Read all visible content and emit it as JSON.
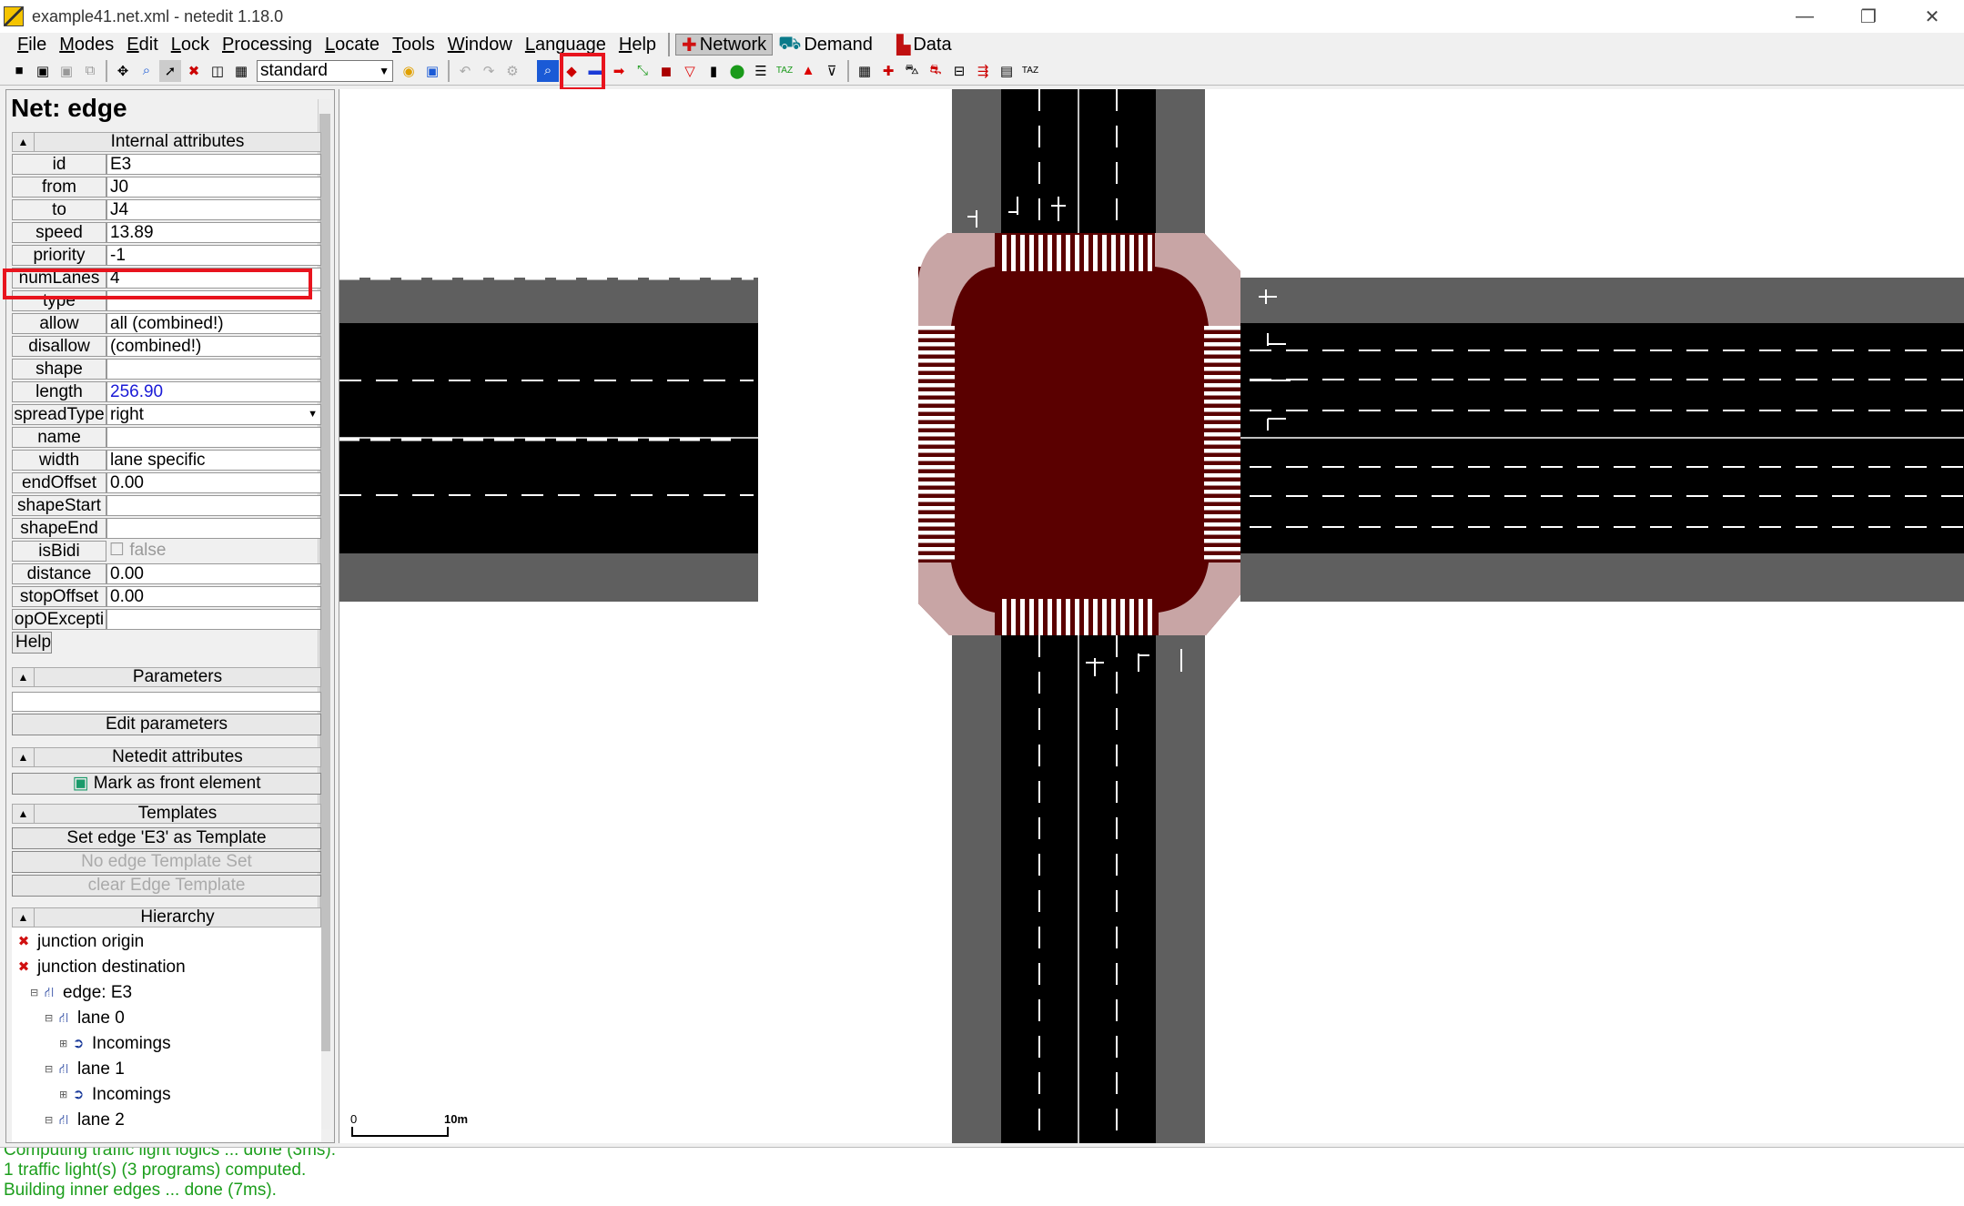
{
  "window": {
    "title": "example41.net.xml - netedit 1.18.0",
    "controls": [
      "—",
      "❐",
      "✕"
    ]
  },
  "menu": [
    "File",
    "Modes",
    "Edit",
    "Lock",
    "Processing",
    "Locate",
    "Tools",
    "Window",
    "Language",
    "Help"
  ],
  "supermodes": {
    "network": "Network",
    "demand": "Demand",
    "data": "Data"
  },
  "toolbar": {
    "scheme": "standard"
  },
  "panel": {
    "title": "Net: edge",
    "internal_header": "Internal attributes",
    "attributes": [
      {
        "label": "id",
        "value": "E3"
      },
      {
        "label": "from",
        "value": "J0"
      },
      {
        "label": "to",
        "value": "J4"
      },
      {
        "label": "speed",
        "value": "13.89"
      },
      {
        "label": "priority",
        "value": "-1"
      },
      {
        "label": "numLanes",
        "value": "4"
      },
      {
        "label": "type",
        "value": ""
      },
      {
        "label": "allow",
        "value": "all (combined!)"
      },
      {
        "label": "disallow",
        "value": " (combined!)"
      },
      {
        "label": "shape",
        "value": ""
      },
      {
        "label": "length",
        "value": "256.90"
      },
      {
        "label": "spreadType",
        "value": "right"
      },
      {
        "label": "name",
        "value": ""
      },
      {
        "label": "width",
        "value": "lane specific"
      },
      {
        "label": "endOffset",
        "value": "0.00"
      },
      {
        "label": "shapeStart",
        "value": ""
      },
      {
        "label": "shapeEnd",
        "value": ""
      },
      {
        "label": "isBidi",
        "value": "false"
      },
      {
        "label": "distance",
        "value": "0.00"
      },
      {
        "label": "stopOffset",
        "value": "0.00"
      },
      {
        "label": "opOExcepti",
        "value": ""
      }
    ],
    "help": "Help",
    "parameters_header": "Parameters",
    "edit_parameters": "Edit parameters",
    "netedit_header": "Netedit attributes",
    "mark_front": "Mark as front element",
    "templates_header": "Templates",
    "set_template": "Set edge 'E3' as Template",
    "no_template": "No edge Template Set",
    "clear_template": "clear Edge Template",
    "hierarchy_header": "Hierarchy",
    "hierarchy": [
      {
        "text": "junction origin",
        "indent": 0
      },
      {
        "text": "junction destination",
        "indent": 0
      },
      {
        "text": "edge: E3",
        "indent": 1
      },
      {
        "text": "lane 0",
        "indent": 2
      },
      {
        "text": "Incomings",
        "indent": 3
      },
      {
        "text": "lane 1",
        "indent": 2
      },
      {
        "text": "Incomings",
        "indent": 3
      },
      {
        "text": "lane 2",
        "indent": 2
      }
    ]
  },
  "view": {
    "scale_zero": "0",
    "scale_label": "10m"
  },
  "log": [
    "Computing traffic light logics ... done (3ms).",
    " 1 traffic light(s) (3 programs) computed.",
    "Building inner edges ... done (7ms)."
  ]
}
